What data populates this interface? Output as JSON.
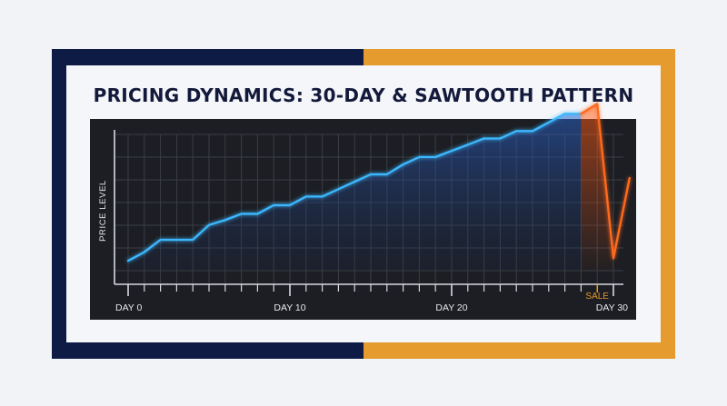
{
  "chart_data": {
    "type": "line",
    "title": "PRICING DYNAMICS: 30-DAY & SAWTOOTH PATTERN",
    "xlabel": "",
    "ylabel": "PRICE LEVEL",
    "x_tick_labels": [
      {
        "x": 0,
        "label": "DAY 0"
      },
      {
        "x": 10,
        "label": "DAY 10"
      },
      {
        "x": 20,
        "label": "DAY 20"
      },
      {
        "x": 30,
        "label": "DAY 30"
      }
    ],
    "annotation": {
      "x": 29,
      "label": "SALE"
    },
    "xlim": [
      0,
      31
    ],
    "ylim": [
      0,
      1
    ],
    "grid": true,
    "series": [
      {
        "color": "#3bb8ff",
        "x": [
          0,
          1,
          2,
          3,
          4,
          5,
          6,
          7,
          8,
          9,
          10,
          11,
          12,
          13,
          14,
          15,
          16,
          17,
          18,
          19,
          20,
          21,
          22,
          23,
          24,
          25,
          26,
          27,
          28
        ],
        "y": [
          0.08,
          0.15,
          0.25,
          0.25,
          0.25,
          0.37,
          0.41,
          0.46,
          0.46,
          0.53,
          0.53,
          0.6,
          0.6,
          0.66,
          0.72,
          0.78,
          0.78,
          0.86,
          0.92,
          0.92,
          0.97,
          1.02,
          1.07,
          1.07,
          1.13,
          1.13,
          1.2,
          1.27,
          1.27
        ]
      },
      {
        "color": "#ff6a1f",
        "x": [
          28,
          29,
          30,
          31
        ],
        "y": [
          1.27,
          1.35,
          0.1,
          0.75
        ]
      }
    ]
  }
}
